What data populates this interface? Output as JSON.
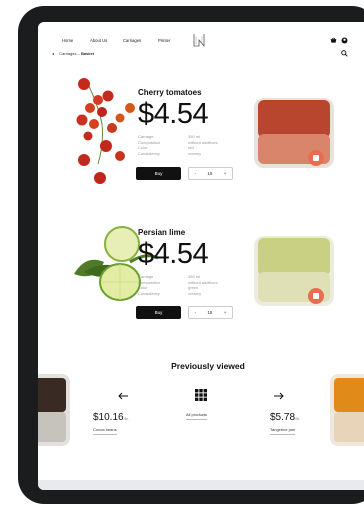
{
  "nav": {
    "links": [
      "Home",
      "About Us",
      "Carriages",
      "Printer"
    ]
  },
  "breadcrumb": {
    "back": "◂",
    "path": "Carriages",
    "separator": " – ",
    "current": "Basket"
  },
  "icons": {
    "cart": "cart-icon",
    "user": "user-icon",
    "search": "search-icon",
    "logo": "brand-logo-icon"
  },
  "products": [
    {
      "name": "Cherry tomatoes",
      "price": "$4.54",
      "specs": [
        {
          "k": "Carriage",
          "v": "350 ml"
        },
        {
          "k": "Composition",
          "v": "without additives"
        },
        {
          "k": "Color",
          "v": "red"
        },
        {
          "k": "Consistency",
          "v": "creamy"
        }
      ],
      "buy_label": "Buy",
      "qty_minus": "-",
      "qty_value": "15",
      "qty_plus": "+",
      "accent": "#c75742"
    },
    {
      "name": "Persian lime",
      "price": "$4.54",
      "specs": [
        {
          "k": "Carriage",
          "v": "350 ml"
        },
        {
          "k": "Composition",
          "v": "without additives"
        },
        {
          "k": "Color",
          "v": "green"
        },
        {
          "k": "Consistency",
          "v": "creamy"
        }
      ],
      "buy_label": "Buy",
      "qty_minus": "-",
      "qty_value": "15",
      "qty_plus": "+",
      "accent": "#c9cf83"
    }
  ],
  "previously_viewed": {
    "title": "Previously viewed",
    "items": [
      {
        "price": "$10.16",
        "unit": "/lb.",
        "label": "Cocoa beans"
      },
      {
        "price": "$5.78",
        "unit": "/lb.",
        "label": "Tangerine jam"
      }
    ],
    "all_products_label": "All products"
  },
  "colors": {
    "badge": "#e86c4f",
    "device": "#1b1c1e"
  }
}
